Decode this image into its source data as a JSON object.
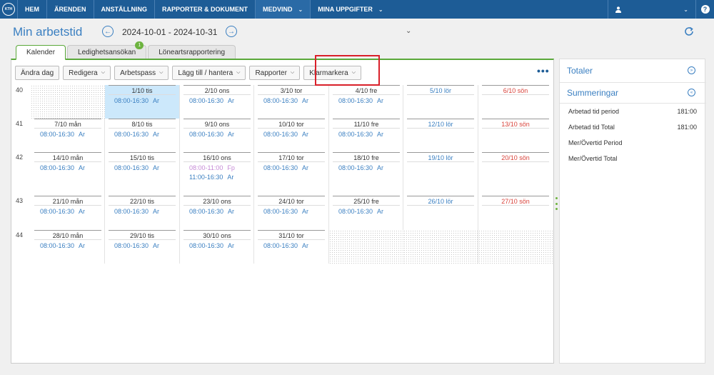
{
  "nav": {
    "logo_text": "KTH",
    "items": [
      {
        "label": "HEM"
      },
      {
        "label": "ÄRENDEN"
      },
      {
        "label": "ANSTÄLLNING"
      },
      {
        "label": "RAPPORTER & DOKUMENT"
      },
      {
        "label": "MEDVIND",
        "dropdown": true,
        "active": true
      },
      {
        "label": "MINA UPPGIFTER",
        "dropdown": true
      }
    ],
    "user_icon": "user-icon",
    "help_label": "?"
  },
  "header": {
    "title": "Min arbetstid",
    "date_range": "2024-10-01 - 2024-10-31"
  },
  "tabs": [
    {
      "label": "Kalender",
      "active": true
    },
    {
      "label": "Ledighetsansökan",
      "badge": "1"
    },
    {
      "label": "Löneartsrapportering"
    }
  ],
  "toolbar": {
    "buttons": [
      {
        "label": "Ändra dag",
        "dropdown": false
      },
      {
        "label": "Redigera",
        "dropdown": true
      },
      {
        "label": "Arbetspass",
        "dropdown": true
      },
      {
        "label": "Lägg till / hantera",
        "dropdown": true
      },
      {
        "label": "Rapporter",
        "dropdown": true
      },
      {
        "label": "Klarmarkera",
        "dropdown": true
      }
    ],
    "more_label": "•••"
  },
  "calendar": {
    "weeks": [
      {
        "week": "40",
        "days": [
          null,
          {
            "label": "1/10 tis",
            "entries": [
              {
                "time": "08:00-16:30",
                "code": "Ar"
              }
            ],
            "today": true
          },
          {
            "label": "2/10 ons",
            "entries": [
              {
                "time": "08:00-16:30",
                "code": "Ar"
              }
            ]
          },
          {
            "label": "3/10 tor",
            "entries": [
              {
                "time": "08:00-16:30",
                "code": "Ar"
              }
            ]
          },
          {
            "label": "4/10 fre",
            "entries": [
              {
                "time": "08:00-16:30",
                "code": "Ar"
              }
            ]
          },
          {
            "label": "5/10 lör",
            "entries": [],
            "type": "sat"
          },
          {
            "label": "6/10 sön",
            "entries": [],
            "type": "sun"
          }
        ]
      },
      {
        "week": "41",
        "days": [
          {
            "label": "7/10 mån",
            "entries": [
              {
                "time": "08:00-16:30",
                "code": "Ar"
              }
            ]
          },
          {
            "label": "8/10 tis",
            "entries": [
              {
                "time": "08:00-16:30",
                "code": "Ar"
              }
            ]
          },
          {
            "label": "9/10 ons",
            "entries": [
              {
                "time": "08:00-16:30",
                "code": "Ar"
              }
            ]
          },
          {
            "label": "10/10 tor",
            "entries": [
              {
                "time": "08:00-16:30",
                "code": "Ar"
              }
            ]
          },
          {
            "label": "11/10 fre",
            "entries": [
              {
                "time": "08:00-16:30",
                "code": "Ar"
              }
            ]
          },
          {
            "label": "12/10 lör",
            "entries": [],
            "type": "sat"
          },
          {
            "label": "13/10 sön",
            "entries": [],
            "type": "sun"
          }
        ]
      },
      {
        "week": "42",
        "days": [
          {
            "label": "14/10 mån",
            "entries": [
              {
                "time": "08:00-16:30",
                "code": "Ar"
              }
            ]
          },
          {
            "label": "15/10 tis",
            "entries": [
              {
                "time": "08:00-16:30",
                "code": "Ar"
              }
            ]
          },
          {
            "label": "16/10 ons",
            "entries": [
              {
                "time": "08:00-11:00",
                "code": "Fp",
                "kind": "fp"
              },
              {
                "time": "11:00-16:30",
                "code": "Ar"
              }
            ]
          },
          {
            "label": "17/10 tor",
            "entries": [
              {
                "time": "08:00-16:30",
                "code": "Ar"
              }
            ]
          },
          {
            "label": "18/10 fre",
            "entries": [
              {
                "time": "08:00-16:30",
                "code": "Ar"
              }
            ]
          },
          {
            "label": "19/10 lör",
            "entries": [],
            "type": "sat"
          },
          {
            "label": "20/10 sön",
            "entries": [],
            "type": "sun"
          }
        ]
      },
      {
        "week": "43",
        "days": [
          {
            "label": "21/10 mån",
            "entries": [
              {
                "time": "08:00-16:30",
                "code": "Ar"
              }
            ]
          },
          {
            "label": "22/10 tis",
            "entries": [
              {
                "time": "08:00-16:30",
                "code": "Ar"
              }
            ]
          },
          {
            "label": "23/10 ons",
            "entries": [
              {
                "time": "08:00-16:30",
                "code": "Ar"
              }
            ]
          },
          {
            "label": "24/10 tor",
            "entries": [
              {
                "time": "08:00-16:30",
                "code": "Ar"
              }
            ]
          },
          {
            "label": "25/10 fre",
            "entries": [
              {
                "time": "08:00-16:30",
                "code": "Ar"
              }
            ]
          },
          {
            "label": "26/10 lör",
            "entries": [],
            "type": "sat"
          },
          {
            "label": "27/10 sön",
            "entries": [],
            "type": "sun"
          }
        ]
      },
      {
        "week": "44",
        "days": [
          {
            "label": "28/10 mån",
            "entries": [
              {
                "time": "08:00-16:30",
                "code": "Ar"
              }
            ]
          },
          {
            "label": "29/10 tis",
            "entries": [
              {
                "time": "08:00-16:30",
                "code": "Ar"
              }
            ]
          },
          {
            "label": "30/10 ons",
            "entries": [
              {
                "time": "08:00-16:30",
                "code": "Ar"
              }
            ]
          },
          {
            "label": "31/10 tor",
            "entries": [
              {
                "time": "08:00-16:30",
                "code": "Ar"
              }
            ]
          },
          null,
          null,
          null
        ]
      }
    ]
  },
  "right_panel": {
    "totaler_label": "Totaler",
    "summeringar_label": "Summeringar",
    "rows": [
      {
        "label": "Arbetad tid period",
        "value": "181:00"
      },
      {
        "label": "Arbetad tid Total",
        "value": "181:00"
      },
      {
        "label": "Mer/Övertid Period",
        "value": ""
      },
      {
        "label": "Mer/Övertid Total",
        "value": ""
      }
    ]
  }
}
